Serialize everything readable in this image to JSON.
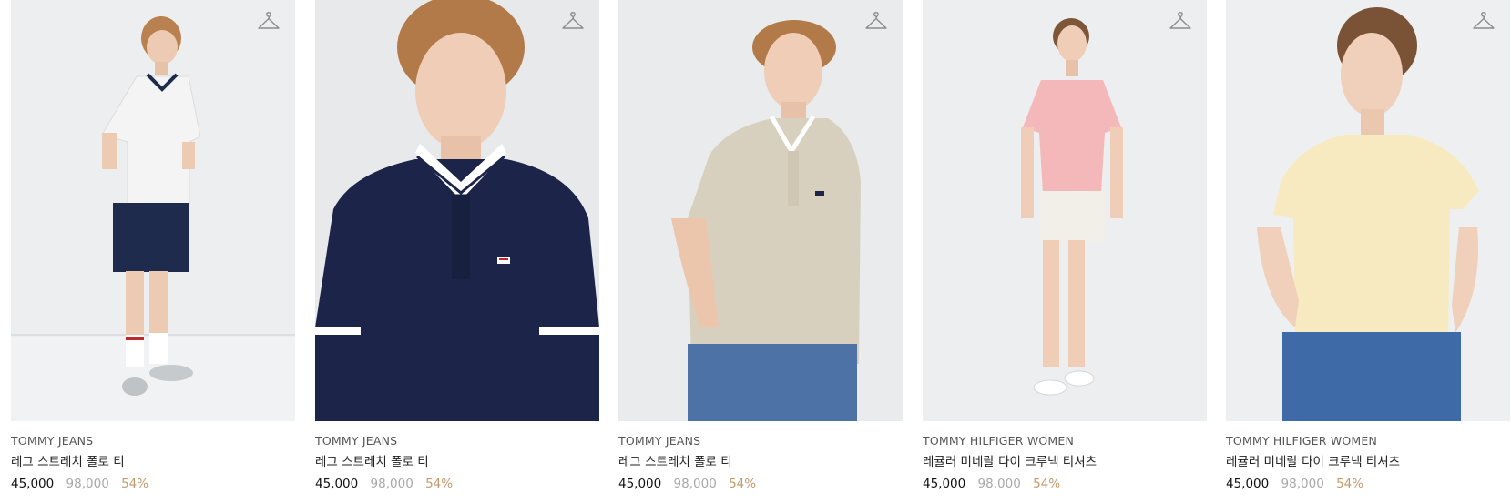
{
  "products": [
    {
      "brand": "TOMMY JEANS",
      "name": "레그 스트레치 폴로 티",
      "sale_price": "45,000",
      "original_price": "98,000",
      "discount": "54%",
      "garment": "white polo shirt with navy shorts",
      "top_color": "#f4f4f4",
      "bottom_color": "#1f2b4d"
    },
    {
      "brand": "TOMMY JEANS",
      "name": "레그 스트레치 폴로 티",
      "sale_price": "45,000",
      "original_price": "98,000",
      "discount": "54%",
      "garment": "navy polo shirt close-up",
      "top_color": "#1c2549",
      "bottom_color": "#1c2549"
    },
    {
      "brand": "TOMMY JEANS",
      "name": "레그 스트레치 폴로 티",
      "sale_price": "45,000",
      "original_price": "98,000",
      "discount": "54%",
      "garment": "beige polo shirt with blue jeans",
      "top_color": "#d8d0bf",
      "bottom_color": "#4d73a6"
    },
    {
      "brand": "TOMMY HILFIGER WOMEN",
      "name": "레귤러 미네랄 다이 크루넥 티셔츠",
      "sale_price": "45,000",
      "original_price": "98,000",
      "discount": "54%",
      "garment": "pink crewneck t-shirt with white shorts",
      "top_color": "#f4b8bb",
      "bottom_color": "#f2efe8"
    },
    {
      "brand": "TOMMY HILFIGER WOMEN",
      "name": "레귤러 미네랄 다이 크루넥 티셔츠",
      "sale_price": "45,000",
      "original_price": "98,000",
      "discount": "54%",
      "garment": "yellow crewneck t-shirt with blue jeans",
      "top_color": "#f8eac0",
      "bottom_color": "#3f6aa8"
    }
  ],
  "icons": {
    "wishlist": "hanger-icon"
  },
  "colors": {
    "sale_price": "#111111",
    "original_price": "#a8a8a8",
    "discount": "#c29a6c",
    "image_background": "#e9ebed"
  }
}
